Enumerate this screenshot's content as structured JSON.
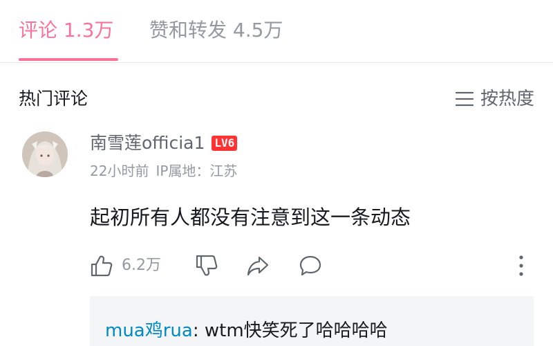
{
  "tabs": {
    "comments": "评论 1.3万",
    "likes_reposts": "赞和转发 4.5万"
  },
  "section": {
    "title": "热门评论",
    "sort_label": "按热度"
  },
  "comment": {
    "username": "南雪莲officia1",
    "level": "LV6",
    "time": "22小时前",
    "ip_location": "IP属地：江苏",
    "text": "起初所有人都没有注意到这一条动态",
    "like_count": "6.2万"
  },
  "reply": {
    "username": "mua鸡rua",
    "separator": ":",
    "text": " wtm快笑死了哈哈哈哈"
  },
  "colors": {
    "accent": "#fb7299",
    "link": "#008ac5",
    "level_badge": "#ff3333",
    "muted_text": "#9499a0"
  },
  "icons": {
    "sort": "sort-lines-icon",
    "like": "thumbs-up-icon",
    "dislike": "thumbs-down-icon",
    "share": "share-arrow-icon",
    "reply": "speech-bubble-icon",
    "more": "vertical-dots-icon"
  }
}
